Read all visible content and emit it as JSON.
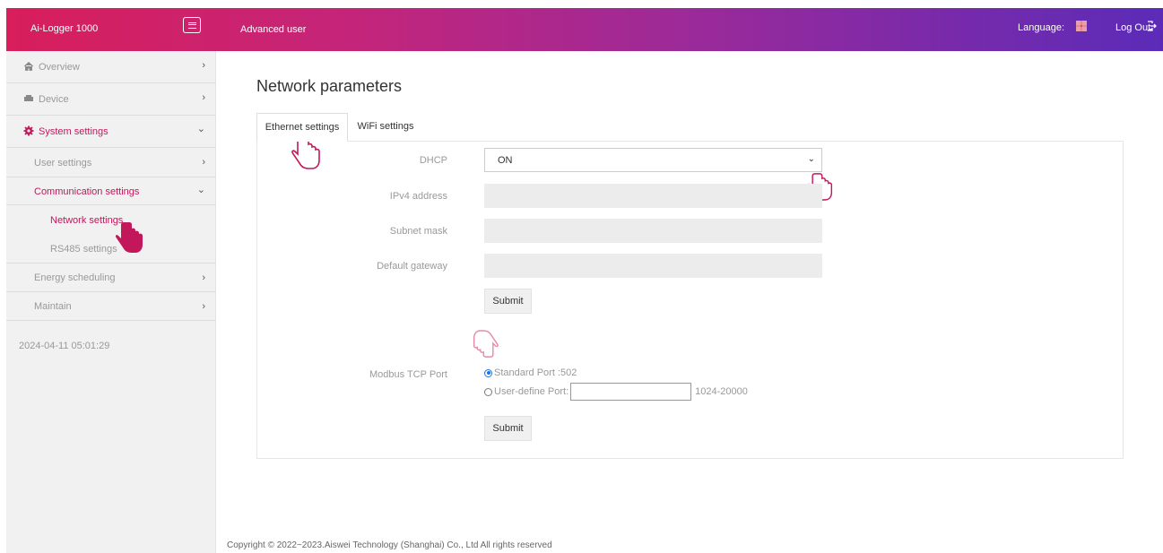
{
  "header": {
    "brand": "Ai-Logger 1000",
    "role": "Advanced user",
    "language_label": "Language:",
    "logout_label": "Log Out",
    "accent": "#d81e5b"
  },
  "sidebar": {
    "items": [
      {
        "label": "Overview",
        "icon": "home-icon"
      },
      {
        "label": "Device",
        "icon": "device-icon"
      },
      {
        "label": "System settings",
        "icon": "gear-icon"
      },
      {
        "label": "User settings"
      },
      {
        "label": "Communication settings"
      },
      {
        "label": "Energy scheduling"
      },
      {
        "label": "Maintain"
      }
    ],
    "sub_items": [
      "Network settings",
      "RS485 settings"
    ],
    "timestamp": "2024-04-11 05:01:29"
  },
  "main": {
    "title": "Network parameters",
    "tabs": [
      "Ethernet settings",
      "WiFi settings"
    ],
    "labels": {
      "dhcp": "DHCP",
      "ipv4": "IPv4 address",
      "subnet": "Subnet mask",
      "gateway": "Default gateway",
      "modbus": "Modbus TCP Port"
    },
    "dhcp_value": "ON",
    "submit_label": "Submit",
    "standard_port": "Standard Port :502",
    "user_define_port": "User-define Port:",
    "port_range": "1024-20000"
  },
  "footer": {
    "copyright": "Copyright © 2022~2023.Aiswei Technology (Shanghai) Co., Ltd All rights reserved"
  }
}
